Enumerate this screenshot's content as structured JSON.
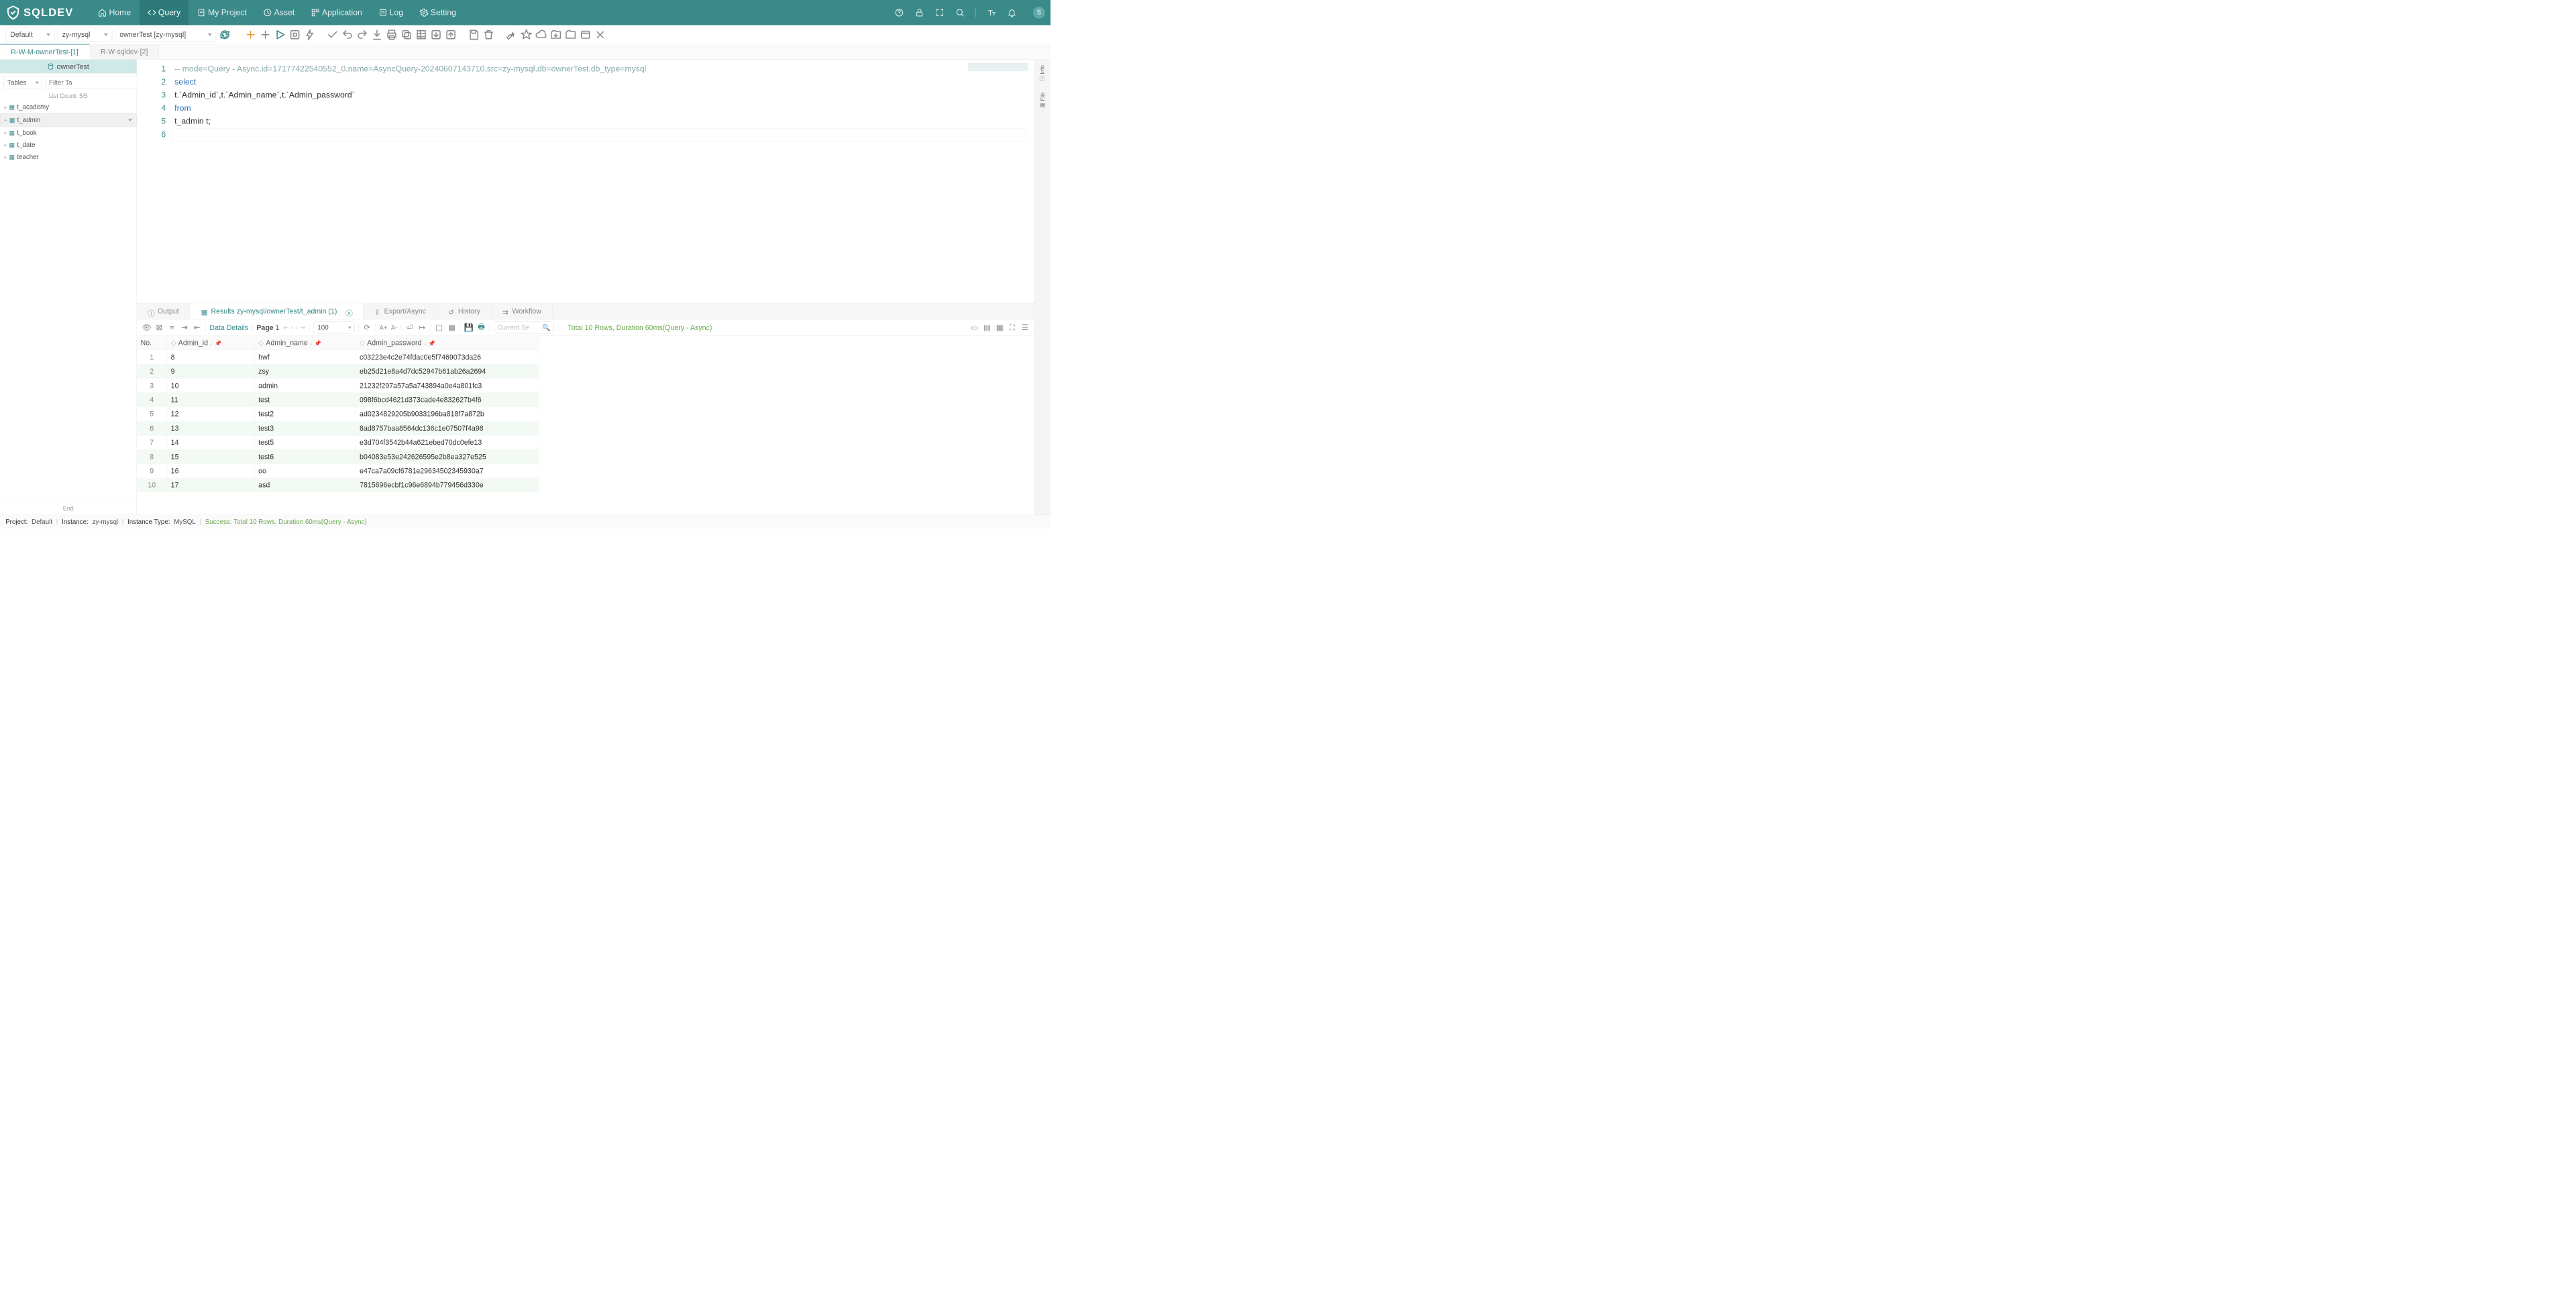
{
  "brand": "SQLDEV",
  "nav": {
    "home": "Home",
    "query": "Query",
    "project": "My Project",
    "asset": "Asset",
    "application": "Application",
    "log": "Log",
    "setting": "Setting"
  },
  "avatar_letter": "S",
  "selectors": {
    "project": "Default",
    "instance": "zy-mysql",
    "database": "ownerTest [zy-mysql]"
  },
  "file_tabs": {
    "t1": "R-W-M-ownerTest-[1]",
    "t2": "R-W-sqldev-[2]"
  },
  "sidebar": {
    "db_label": "ownerTest",
    "type_sel": "Tables",
    "filter_placeholder": "Filter Ta",
    "list_count": "List Count:  5/5",
    "items": [
      "t_academy",
      "t_admin",
      "t_book",
      "t_date",
      "teacher"
    ],
    "end": "End"
  },
  "code": {
    "l1": "-- mode=Query - Async,id=17177422540552_0,name=AsyncQuery-20240607143710,src=zy-mysql,db=ownerTest,db_type=mysql",
    "l2": "select",
    "l3_indent": "    t.`Admin_id`,t.`Admin_name`,t.`Admin_password`",
    "l4": "from",
    "l5_indent": "    t_admin t;"
  },
  "result_tabs": {
    "output": "Output",
    "results": "Results zy-mysql/ownerTest/t_admin  (1)",
    "export": "Export/Async",
    "history": "History",
    "workflow": "Workflow"
  },
  "result_toolbar": {
    "data_details": "Data Details",
    "page_label": "Page",
    "page_no": "1",
    "page_size": "100",
    "font_inc": "A+",
    "font_dec": "A-",
    "search_placeholder": "Current Se",
    "summary": "Total 10 Rows, Duration 60ms(Query - Async)"
  },
  "columns": {
    "no": "No.",
    "c1": "Admin_id",
    "c2": "Admin_name",
    "c3": "Admin_password"
  },
  "rows": [
    {
      "no": "1",
      "id": "8",
      "name": "hwf",
      "pw": "c03223e4c2e74fdac0e5f7469073da26"
    },
    {
      "no": "2",
      "id": "9",
      "name": "zsy",
      "pw": "eb25d21e8a4d7dc52947b61ab26a2694"
    },
    {
      "no": "3",
      "id": "10",
      "name": "admin",
      "pw": "21232f297a57a5a743894a0e4a801fc3"
    },
    {
      "no": "4",
      "id": "11",
      "name": "test",
      "pw": "098f6bcd4621d373cade4e832627b4f6"
    },
    {
      "no": "5",
      "id": "12",
      "name": "test2",
      "pw": "ad0234829205b9033196ba818f7a872b"
    },
    {
      "no": "6",
      "id": "13",
      "name": "test3",
      "pw": "8ad8757baa8564dc136c1e07507f4a98"
    },
    {
      "no": "7",
      "id": "14",
      "name": "test5",
      "pw": "e3d704f3542b44a621ebed70dc0efe13"
    },
    {
      "no": "8",
      "id": "15",
      "name": "test6",
      "pw": "b04083e53e242626595e2b8ea327e525"
    },
    {
      "no": "9",
      "id": "16",
      "name": "oo",
      "pw": "e47ca7a09cf6781e29634502345930a7"
    },
    {
      "no": "10",
      "id": "17",
      "name": "asd",
      "pw": "7815696ecbf1c96e6894b779456d330e"
    }
  ],
  "rail": {
    "info": "Info",
    "file": "File"
  },
  "status": {
    "project_l": "Project:",
    "project_v": "Default",
    "instance_l": "Instance:",
    "instance_v": "zy-mysql",
    "type_l": "Instance Type:",
    "type_v": "MySQL",
    "success_l": "Success:",
    "success_v": "Total 10 Rows, Duration 60ms(Query - Async)"
  }
}
